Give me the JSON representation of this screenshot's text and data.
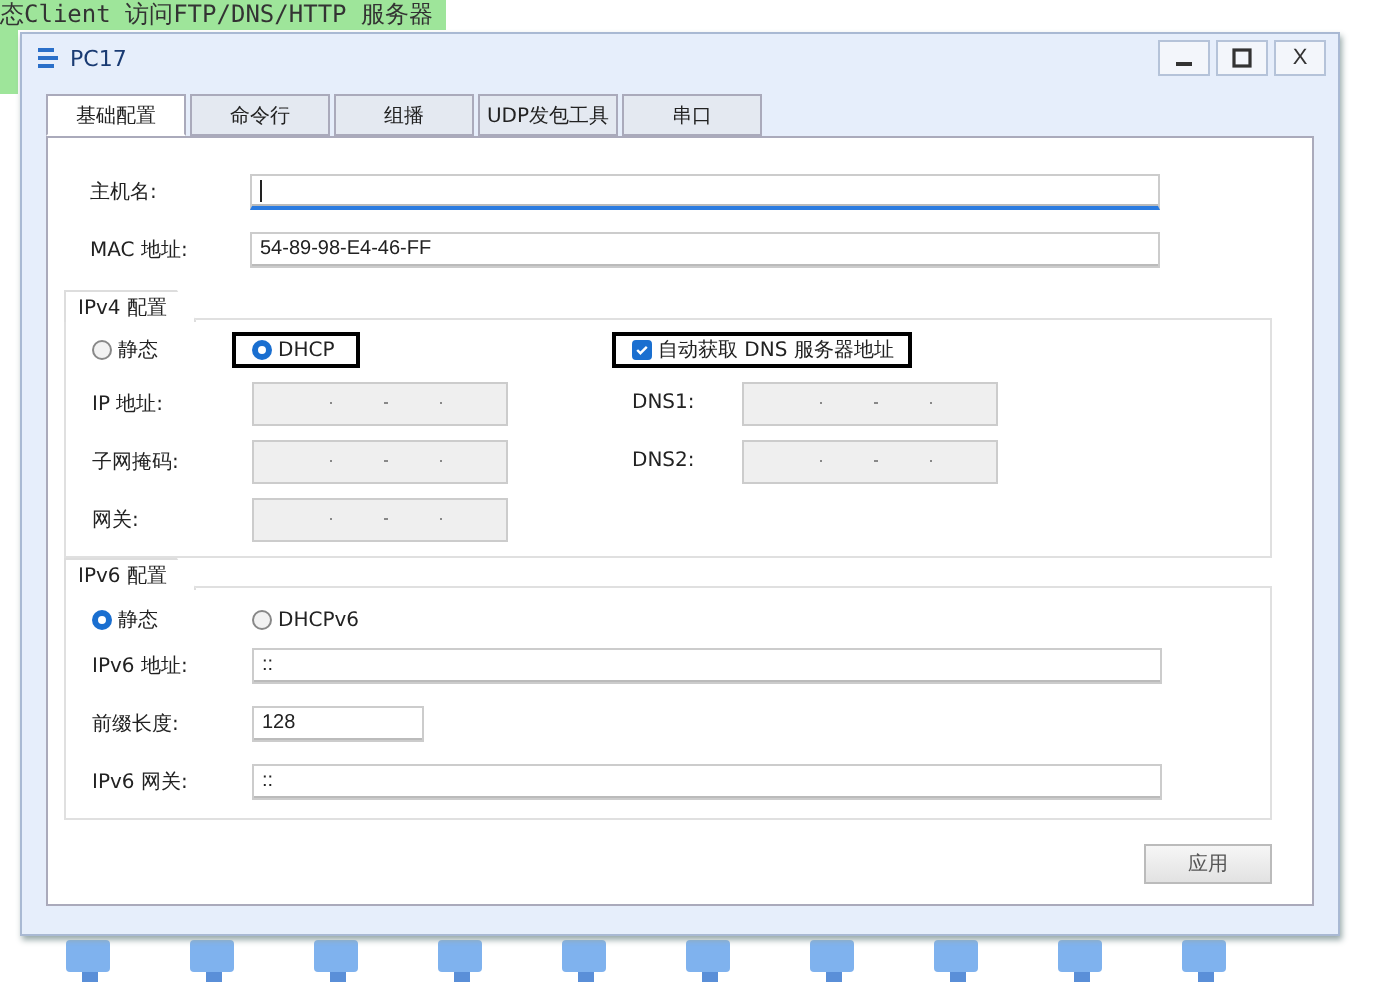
{
  "background": {
    "banner": "态Client 访问FTP/DNS/HTTP 服务器"
  },
  "window": {
    "title": "PC17",
    "buttons": [
      {
        "kind": "minimize"
      },
      {
        "kind": "maximize"
      },
      {
        "kind": "close",
        "label": "X"
      }
    ]
  },
  "tabs": [
    {
      "label": "基础配置",
      "selected": true
    },
    {
      "label": "命令行",
      "selected": false
    },
    {
      "label": "组播",
      "selected": false
    },
    {
      "label": "UDP发包工具",
      "selected": false
    },
    {
      "label": "串口",
      "selected": false
    }
  ],
  "host": {
    "label": "主机名:",
    "focused": true
  },
  "mac": {
    "label": "MAC 地址:",
    "value": "54-89-98-E4-46-FF"
  },
  "ipv4": {
    "title": "IPv4 配置",
    "modes": [
      {
        "label": "静态",
        "selected": false,
        "highlighted": false
      },
      {
        "label": "DHCP",
        "selected": true,
        "highlighted": true
      }
    ],
    "dns_auto": {
      "label": "自动获取 DNS 服务器地址",
      "checked": true,
      "highlighted": true
    },
    "fields": [
      {
        "label": "IP 地址:",
        "disabled": true
      },
      {
        "label": "子网掩码:",
        "disabled": true
      },
      {
        "label": "网关:",
        "disabled": true
      }
    ],
    "dns_fields": [
      {
        "label": "DNS1:",
        "disabled": true
      },
      {
        "label": "DNS2:",
        "disabled": true
      }
    ]
  },
  "ipv6": {
    "title": "IPv6 配置",
    "modes": [
      {
        "label": "静态",
        "selected": true
      },
      {
        "label": "DHCPv6",
        "selected": false
      }
    ],
    "fields": [
      {
        "label": "IPv6 地址:",
        "value": "::",
        "kind": "wide"
      },
      {
        "label": "前缀长度:",
        "value": "128",
        "kind": "short"
      },
      {
        "label": "IPv6 网关:",
        "value": "::",
        "kind": "wide"
      }
    ]
  },
  "apply_button": "应用"
}
